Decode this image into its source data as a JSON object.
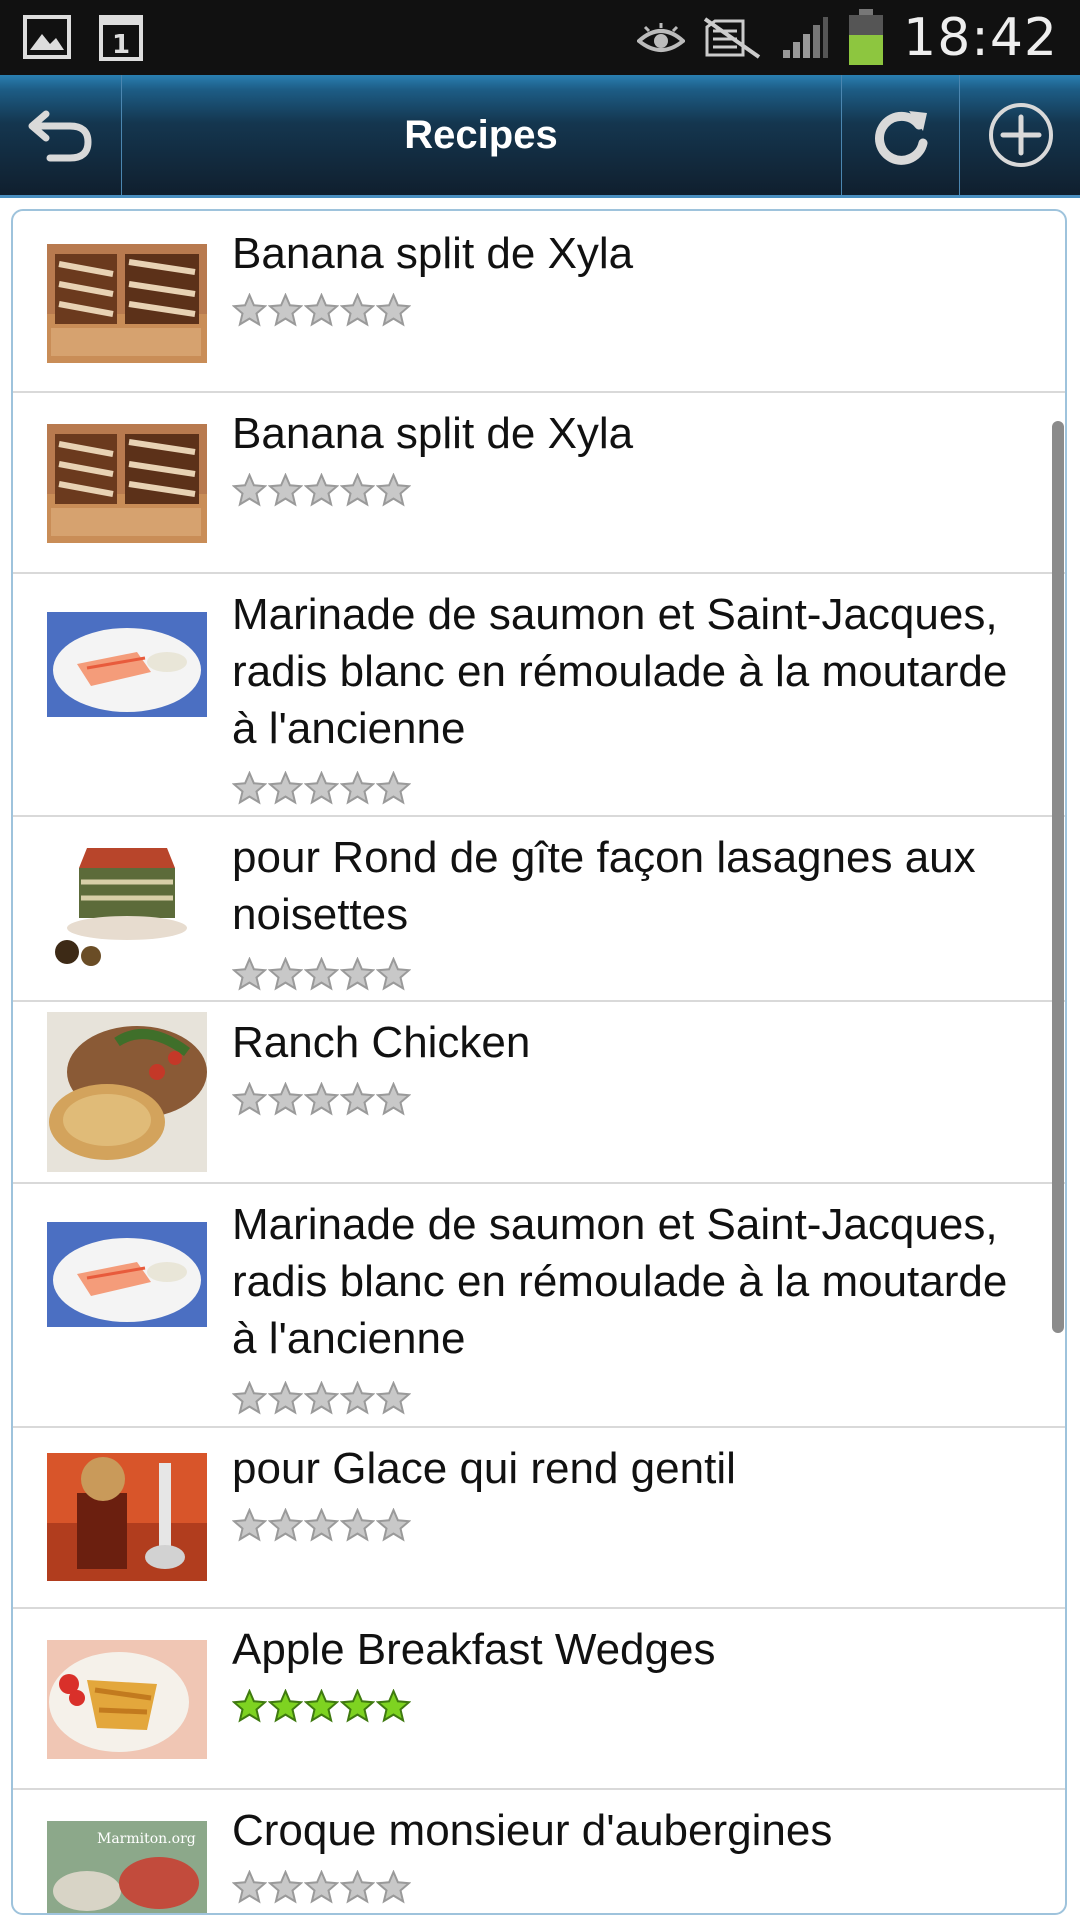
{
  "status_bar": {
    "time": "18:42",
    "notification_count": "1",
    "icons": [
      "gallery-icon",
      "calendar-icon",
      "eye-icon",
      "no-sim-icon",
      "signal-icon",
      "battery-icon"
    ]
  },
  "action_bar": {
    "title": "Recipes",
    "back_icon": "back-arrow-icon",
    "refresh_icon": "refresh-icon",
    "add_icon": "add-circle-icon"
  },
  "colors": {
    "star_empty": "#c8c8c8",
    "star_filled": "#7ed321",
    "actionbar_accent": "#4a8fc0"
  },
  "recipes": [
    {
      "title": "Banana split de Xyla",
      "rating": 0,
      "image": "banana-split-image"
    },
    {
      "title": "Banana split de Xyla",
      "rating": 0,
      "image": "banana-split-image"
    },
    {
      "title": "Marinade de saumon et Saint-Jacques, radis blanc en rémoulade à la moutarde à l'ancienne",
      "rating": 0,
      "image": "salmon-plate-image"
    },
    {
      "title": "pour Rond de gîte façon lasagnes aux noisettes",
      "rating": 0,
      "image": "lasagne-image"
    },
    {
      "title": "Ranch Chicken",
      "rating": 0,
      "image": "ranch-chicken-image"
    },
    {
      "title": "Marinade de saumon et Saint-Jacques, radis blanc en rémoulade à la moutarde à l'ancienne",
      "rating": 0,
      "image": "salmon-plate-image"
    },
    {
      "title": "pour Glace qui rend gentil",
      "rating": 0,
      "image": "ice-cream-image"
    },
    {
      "title": "Apple Breakfast Wedges",
      "rating": 5,
      "image": "apple-wedges-image"
    },
    {
      "title": "Croque monsieur d'aubergines",
      "rating": 0,
      "image": "croque-aubergine-image"
    }
  ],
  "thumb_watermark": "Marmiton.org"
}
